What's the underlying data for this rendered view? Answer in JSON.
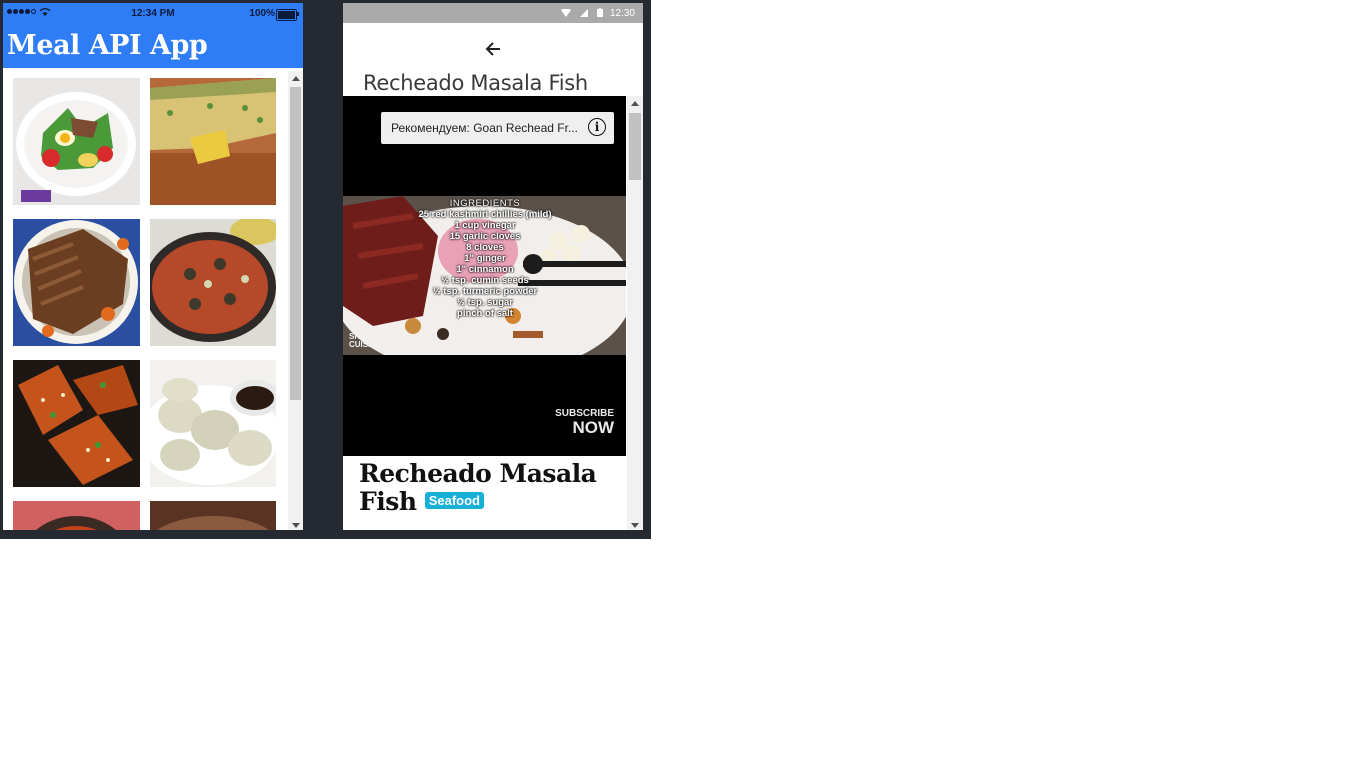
{
  "left_phone": {
    "status": {
      "time": "12:34 PM",
      "battery_text": "100%"
    },
    "header": {
      "title": "Meal API App"
    },
    "meals": [
      {
        "icon": "salad-photo"
      },
      {
        "icon": "casserole-photo"
      },
      {
        "icon": "roast-beef-photo"
      },
      {
        "icon": "paella-photo"
      },
      {
        "icon": "glazed-salmon-photo"
      },
      {
        "icon": "dumplings-photo"
      },
      {
        "icon": "stew-photo"
      },
      {
        "icon": "soup-photo"
      }
    ]
  },
  "right_phone": {
    "status": {
      "time": "12:30"
    },
    "page_title": "Recheado Masala Fish",
    "video": {
      "recommendation": "Рекомендуем: Goan Rechead Fr...",
      "ingredients_header": "INGREDIENTS",
      "ingredients": [
        "25 red kashmiri chillies (mild)",
        "1 cup vinegar",
        "15 garlic cloves",
        "8 cloves",
        "1\" ginger",
        "1\" cinnamon",
        "½ tsp. cumin seeds",
        "½ tsp. turmeric powder",
        "½ tsp. sugar",
        "pinch of salt"
      ],
      "watermark": "SHAMS CUISINE",
      "subscribe_line1": "SUBSCRIBE",
      "subscribe_line2": "NOW"
    },
    "meal": {
      "name": "Recheado Masala Fish",
      "category": "Seafood"
    }
  },
  "colors": {
    "ios_header": "#2f7df6",
    "badge": "#17b1d8"
  }
}
